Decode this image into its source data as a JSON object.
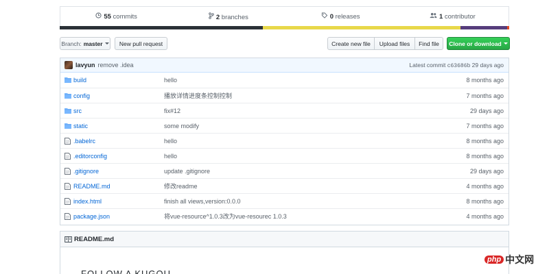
{
  "summary": {
    "commits": {
      "count": "55",
      "label": "commits",
      "icon": "history-icon"
    },
    "branches": {
      "count": "2",
      "label": "branches",
      "icon": "branch-icon"
    },
    "releases": {
      "count": "0",
      "label": "releases",
      "icon": "tag-icon"
    },
    "contributors": {
      "count": "1",
      "label": "contributor",
      "icon": "people-icon"
    }
  },
  "language_colors": [
    "#2b3137",
    "#e8d84a",
    "#563d7c",
    "#e34c26"
  ],
  "toolbar": {
    "branch_prefix": "Branch:",
    "branch_name": "master",
    "new_pr": "New pull request",
    "create_file": "Create new file",
    "upload": "Upload files",
    "find_file": "Find file",
    "clone": "Clone or download"
  },
  "latest_commit": {
    "author": "lavyun",
    "message": "remove .idea",
    "prefix": "Latest commit",
    "sha": "c63686b",
    "age": "29 days ago"
  },
  "files": [
    {
      "type": "dir",
      "name": "build",
      "message": "hello",
      "age": "8 months ago"
    },
    {
      "type": "dir",
      "name": "config",
      "message": "播放详情进度条控制控制",
      "age": "7 months ago"
    },
    {
      "type": "dir",
      "name": "src",
      "message": "fix#12",
      "age": "29 days ago"
    },
    {
      "type": "dir",
      "name": "static",
      "message": "some modify",
      "age": "7 months ago"
    },
    {
      "type": "file",
      "name": ".babelrc",
      "message": "hello",
      "age": "8 months ago"
    },
    {
      "type": "file",
      "name": ".editorconfig",
      "message": "hello",
      "age": "8 months ago"
    },
    {
      "type": "file",
      "name": ".gitignore",
      "message": "update .gitignore",
      "age": "29 days ago"
    },
    {
      "type": "file",
      "name": "README.md",
      "message": "修改readme",
      "age": "4 months ago"
    },
    {
      "type": "file",
      "name": "index.html",
      "message": "finish all views,version:0.0.0",
      "age": "8 months ago"
    },
    {
      "type": "file",
      "name": "package.json",
      "message": "将vue-resource^1.0.3改为vue-resourec 1.0.3",
      "age": "4 months ago"
    }
  ],
  "readme": {
    "title": "README.md",
    "heading": "FOLLOW A KUGOU"
  },
  "watermark": {
    "badge": "php",
    "text": "中文网"
  }
}
